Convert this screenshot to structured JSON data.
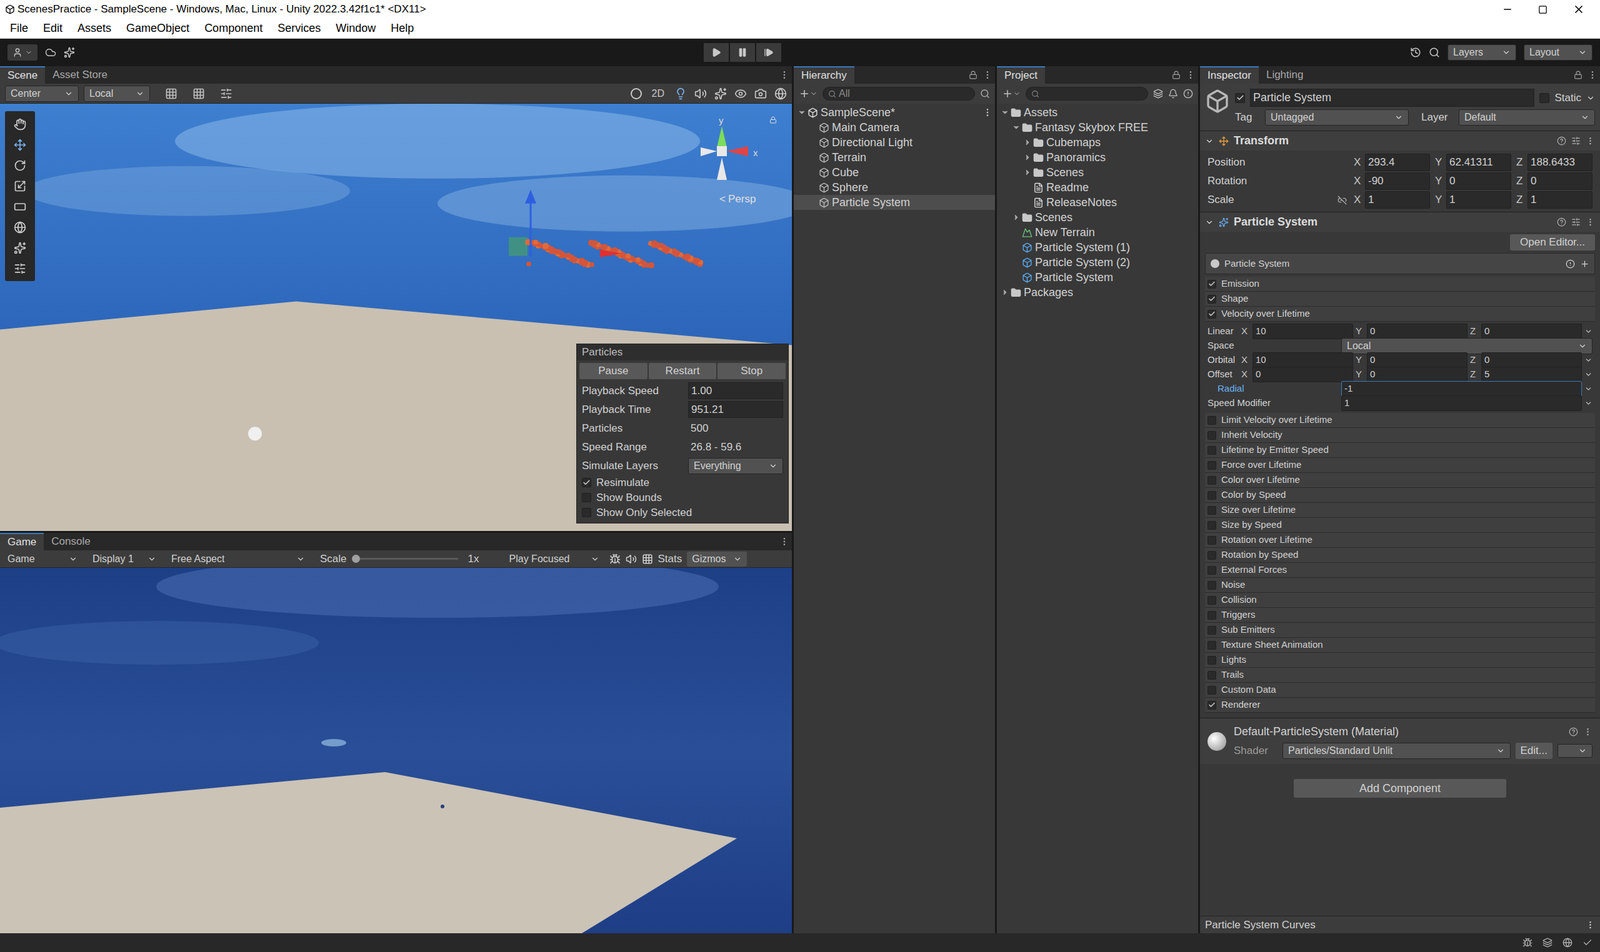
{
  "window": {
    "title": "ScenesPractice - SampleScene - Windows, Mac, Linux - Unity 2022.3.42f1c1* <DX11>"
  },
  "menu": [
    "File",
    "Edit",
    "Assets",
    "GameObject",
    "Component",
    "Services",
    "Window",
    "Help"
  ],
  "toolbar": {
    "layers": "Layers",
    "layout": "Layout"
  },
  "scene": {
    "tabs": [
      {
        "label": "Scene",
        "selected": true
      },
      {
        "label": "Asset Store",
        "selected": false
      }
    ],
    "toolbar": {
      "pivot": "Center",
      "space": "Local",
      "mode2d": "2D"
    },
    "gizmo": {
      "y": "y",
      "x": "x",
      "projection_icon": "<",
      "projection": "Persp"
    }
  },
  "particles_panel": {
    "title": "Particles",
    "buttons": [
      "Pause",
      "Restart",
      "Stop"
    ],
    "rows": [
      {
        "label": "Playback Speed",
        "value": "1.00",
        "kind": "field"
      },
      {
        "label": "Playback Time",
        "value": "951.21",
        "kind": "field"
      },
      {
        "label": "Particles",
        "value": "500",
        "kind": "text"
      },
      {
        "label": "Speed Range",
        "value": "26.8 - 59.6",
        "kind": "text"
      },
      {
        "label": "Simulate Layers",
        "value": "Everything",
        "kind": "dropdown"
      }
    ],
    "checks": [
      {
        "label": "Resimulate",
        "checked": true
      },
      {
        "label": "Show Bounds",
        "checked": false
      },
      {
        "label": "Show Only Selected",
        "checked": false
      }
    ]
  },
  "game": {
    "tabs": [
      {
        "label": "Game",
        "selected": true
      },
      {
        "label": "Console",
        "selected": false
      }
    ],
    "toolbar": {
      "view": "Game",
      "display": "Display 1",
      "aspect": "Free Aspect",
      "scale_label": "Scale",
      "scale_level": 0.0,
      "scale_value": "1x",
      "play_mode": "Play Focused",
      "stats": "Stats",
      "gizmos": "Gizmos"
    }
  },
  "hierarchy": {
    "tab": "Hierarchy",
    "search": "All",
    "items": [
      {
        "label": "SampleScene*",
        "kind": "scene",
        "depth": 0,
        "expandable": true,
        "expanded": true,
        "selected": false
      },
      {
        "label": "Main Camera",
        "kind": "object",
        "depth": 1,
        "expandable": false,
        "expanded": false,
        "selected": false
      },
      {
        "label": "Directional Light",
        "kind": "object",
        "depth": 1,
        "expandable": false,
        "expanded": false,
        "selected": false
      },
      {
        "label": "Terrain",
        "kind": "object",
        "depth": 1,
        "expandable": false,
        "expanded": false,
        "selected": false
      },
      {
        "label": "Cube",
        "kind": "object",
        "depth": 1,
        "expandable": false,
        "expanded": false,
        "selected": false
      },
      {
        "label": "Sphere",
        "kind": "object",
        "depth": 1,
        "expandable": false,
        "expanded": false,
        "selected": false
      },
      {
        "label": "Particle System",
        "kind": "object",
        "depth": 1,
        "expandable": false,
        "expanded": false,
        "selected": true
      }
    ]
  },
  "project": {
    "tab": "Project",
    "search": "",
    "items": [
      {
        "label": "Assets",
        "kind": "folder",
        "depth": 0,
        "expandable": true,
        "expanded": true
      },
      {
        "label": "Fantasy Skybox FREE",
        "kind": "folder",
        "depth": 1,
        "expandable": true,
        "expanded": true
      },
      {
        "label": "Cubemaps",
        "kind": "folder",
        "depth": 2,
        "expandable": true,
        "expanded": false
      },
      {
        "label": "Panoramics",
        "kind": "folder",
        "depth": 2,
        "expandable": true,
        "expanded": false
      },
      {
        "label": "Scenes",
        "kind": "folder",
        "depth": 2,
        "expandable": true,
        "expanded": false
      },
      {
        "label": "Readme",
        "kind": "doc",
        "depth": 2,
        "expandable": false,
        "expanded": false
      },
      {
        "label": "ReleaseNotes",
        "kind": "doc",
        "depth": 2,
        "expandable": false,
        "expanded": false
      },
      {
        "label": "Scenes",
        "kind": "folder",
        "depth": 1,
        "expandable": true,
        "expanded": false
      },
      {
        "label": "New Terrain",
        "kind": "terrain",
        "depth": 1,
        "expandable": false,
        "expanded": false
      },
      {
        "label": "Particle System (1)",
        "kind": "prefab",
        "depth": 1,
        "expandable": false,
        "expanded": false
      },
      {
        "label": "Particle System (2)",
        "kind": "prefab",
        "depth": 1,
        "expandable": false,
        "expanded": false
      },
      {
        "label": "Particle System",
        "kind": "prefab",
        "depth": 1,
        "expandable": false,
        "expanded": false
      },
      {
        "label": "Packages",
        "kind": "folder",
        "depth": 0,
        "expandable": true,
        "expanded": false
      }
    ]
  },
  "inspector": {
    "tabs": [
      {
        "label": "Inspector",
        "selected": true
      },
      {
        "label": "Lighting",
        "selected": false
      }
    ],
    "object": {
      "name": "Particle System",
      "active": true,
      "static_label": "Static",
      "static": false,
      "tag_label": "Tag",
      "tag": "Untagged",
      "layer_label": "Layer",
      "layer": "Default"
    },
    "transform": {
      "title": "Transform",
      "expanded": true,
      "rows": [
        {
          "label": "Position",
          "linked": false,
          "values": [
            {
              "axis": "X",
              "value": "293.4"
            },
            {
              "axis": "Y",
              "value": "62.41311"
            },
            {
              "axis": "Z",
              "value": "188.6433"
            }
          ]
        },
        {
          "label": "Rotation",
          "linked": false,
          "values": [
            {
              "axis": "X",
              "value": "-90"
            },
            {
              "axis": "Y",
              "value": "0"
            },
            {
              "axis": "Z",
              "value": "0"
            }
          ]
        },
        {
          "label": "Scale",
          "linked": true,
          "values": [
            {
              "axis": "X",
              "value": "1"
            },
            {
              "axis": "Y",
              "value": "1"
            },
            {
              "axis": "Z",
              "value": "1"
            }
          ]
        }
      ]
    },
    "particle_system": {
      "title": "Particle System",
      "expanded": true,
      "open_editor": "Open Editor...",
      "main_module": "Particle System",
      "modules": [
        {
          "label": "Emission",
          "enabled": true,
          "expanded": false
        },
        {
          "label": "Shape",
          "enabled": true,
          "expanded": false
        },
        {
          "label": "Velocity over Lifetime",
          "enabled": true,
          "expanded": true
        },
        {
          "label": "Limit Velocity over Lifetime",
          "enabled": false,
          "expanded": false
        },
        {
          "label": "Inherit Velocity",
          "enabled": false,
          "expanded": false
        },
        {
          "label": "Lifetime by Emitter Speed",
          "enabled": false,
          "expanded": false
        },
        {
          "label": "Force over Lifetime",
          "enabled": false,
          "expanded": false
        },
        {
          "label": "Color over Lifetime",
          "enabled": false,
          "expanded": false
        },
        {
          "label": "Color by Speed",
          "enabled": false,
          "expanded": false
        },
        {
          "label": "Size over Lifetime",
          "enabled": false,
          "expanded": false
        },
        {
          "label": "Size by Speed",
          "enabled": false,
          "expanded": false
        },
        {
          "label": "Rotation over Lifetime",
          "enabled": false,
          "expanded": false
        },
        {
          "label": "Rotation by Speed",
          "enabled": false,
          "expanded": false
        },
        {
          "label": "External Forces",
          "enabled": false,
          "expanded": false
        },
        {
          "label": "Noise",
          "enabled": false,
          "expanded": false
        },
        {
          "label": "Collision",
          "enabled": false,
          "expanded": false
        },
        {
          "label": "Triggers",
          "enabled": false,
          "expanded": false
        },
        {
          "label": "Sub Emitters",
          "enabled": false,
          "expanded": false
        },
        {
          "label": "Texture Sheet Animation",
          "enabled": false,
          "expanded": false
        },
        {
          "label": "Lights",
          "enabled": false,
          "expanded": false
        },
        {
          "label": "Trails",
          "enabled": false,
          "expanded": false
        },
        {
          "label": "Custom Data",
          "enabled": false,
          "expanded": false
        },
        {
          "label": "Renderer",
          "enabled": true,
          "expanded": false
        }
      ],
      "velocity_fields": [
        {
          "label": "Linear",
          "kind": "xyz",
          "focused": false,
          "values": [
            {
              "axis": "X",
              "value": "10"
            },
            {
              "axis": "Y",
              "value": "0"
            },
            {
              "axis": "Z",
              "value": "0"
            }
          ]
        },
        {
          "label": "Space",
          "kind": "dropdown",
          "focused": false,
          "value": "Local"
        },
        {
          "label": "Orbital",
          "kind": "xyz",
          "focused": false,
          "values": [
            {
              "axis": "X",
              "value": "10"
            },
            {
              "axis": "Y",
              "value": "0"
            },
            {
              "axis": "Z",
              "value": "0"
            }
          ]
        },
        {
          "label": "Offset",
          "kind": "xyz",
          "focused": false,
          "values": [
            {
              "axis": "X",
              "value": "0"
            },
            {
              "axis": "Y",
              "value": "0"
            },
            {
              "axis": "Z",
              "value": "5"
            }
          ]
        },
        {
          "label": "Radial",
          "kind": "value",
          "focused": true,
          "value": "-1"
        },
        {
          "label": "Speed Modifier",
          "kind": "value",
          "focused": false,
          "value": "1"
        }
      ]
    },
    "material": {
      "name": "Default-ParticleSystem (Material)",
      "shader_label": "Shader",
      "shader": "Particles/Standard Unlit",
      "edit": "Edit..."
    },
    "add_component": "Add Component",
    "curves": "Particle System Curves"
  }
}
